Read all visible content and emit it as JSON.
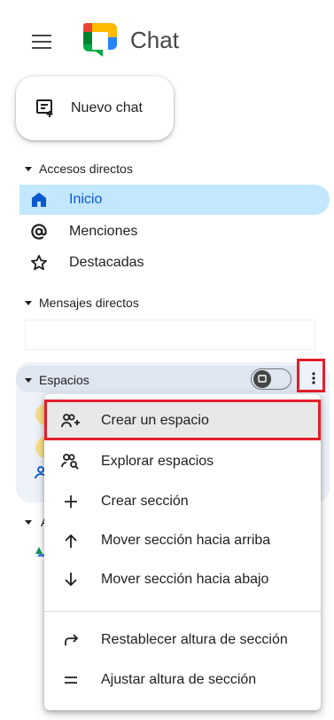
{
  "header": {
    "app_title": "Chat"
  },
  "new_chat": {
    "label": "Nuevo chat"
  },
  "sections": {
    "shortcuts": "Accesos directos",
    "direct_messages": "Mensajes directos",
    "spaces": "Espacios",
    "apps_partial": "A"
  },
  "nav": {
    "home": "Inicio",
    "mentions": "Menciones",
    "starred": "Destacadas"
  },
  "menu": {
    "create_space": "Crear un espacio",
    "browse_spaces": "Explorar espacios",
    "create_section": "Crear sección",
    "move_up": "Mover sección hacia arriba",
    "move_down": "Mover sección hacia abajo",
    "reset_height": "Restablecer altura de sección",
    "adjust_height": "Ajustar altura de sección"
  },
  "colors": {
    "active_bg": "#c2e7ff",
    "active_text": "#0b57d0",
    "highlight_red": "#e41e2b"
  }
}
